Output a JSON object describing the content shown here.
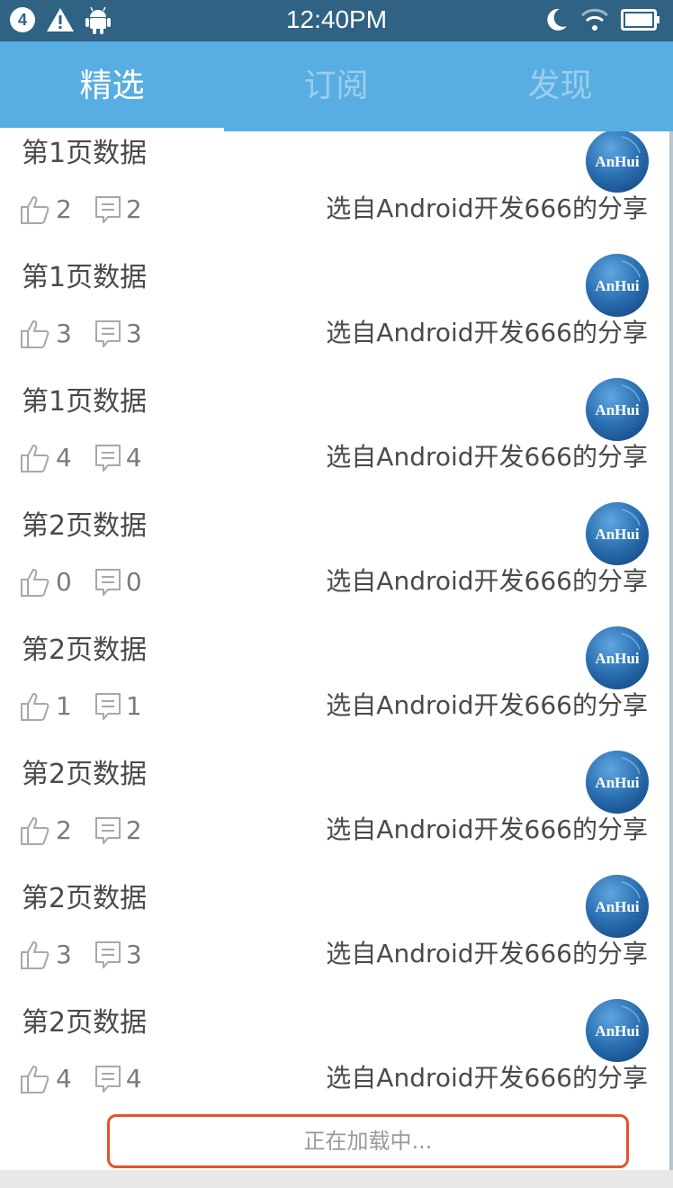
{
  "status_bar": {
    "time": "12:40PM",
    "notification_count": "4",
    "icons": [
      "notification-count-icon",
      "warning-icon",
      "android-icon",
      "moon-icon",
      "wifi-icon",
      "battery-icon"
    ]
  },
  "tabs": [
    {
      "label": "精选",
      "active": true
    },
    {
      "label": "订阅",
      "active": false
    },
    {
      "label": "发现",
      "active": false
    }
  ],
  "items": [
    {
      "title": "第1页数据",
      "likes": "2",
      "comments": "2",
      "source": "选自Android开发666的分享"
    },
    {
      "title": "第1页数据",
      "likes": "3",
      "comments": "3",
      "source": "选自Android开发666的分享"
    },
    {
      "title": "第1页数据",
      "likes": "4",
      "comments": "4",
      "source": "选自Android开发666的分享"
    },
    {
      "title": "第2页数据",
      "likes": "0",
      "comments": "0",
      "source": "选自Android开发666的分享"
    },
    {
      "title": "第2页数据",
      "likes": "1",
      "comments": "1",
      "source": "选自Android开发666的分享"
    },
    {
      "title": "第2页数据",
      "likes": "2",
      "comments": "2",
      "source": "选自Android开发666的分享"
    },
    {
      "title": "第2页数据",
      "likes": "3",
      "comments": "3",
      "source": "选自Android开发666的分享"
    },
    {
      "title": "第2页数据",
      "likes": "4",
      "comments": "4",
      "source": "选自Android开发666的分享"
    }
  ],
  "avatar_text": "AnHui",
  "loading_text": "正在加载中...",
  "colors": {
    "status_bar": "#2f6283",
    "tab_bar": "#58aee2",
    "loading_border": "#e6502b",
    "avatar_blue": "#2a6fb0"
  }
}
